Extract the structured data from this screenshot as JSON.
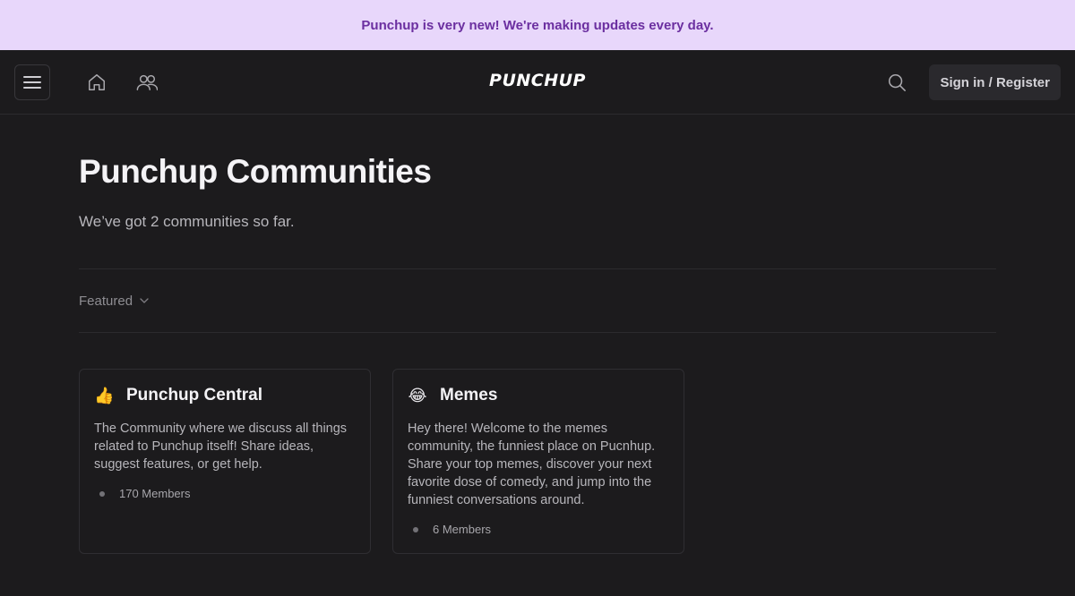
{
  "banner": {
    "text": "Punchup is very new! We're making updates every day."
  },
  "navbar": {
    "menu_icon": "hamburger-menu-icon",
    "home_icon": "home-icon",
    "communities_icon": "people-icon",
    "logo_text": "PUNCHUP",
    "search_icon": "search-icon",
    "signin_label": "Sign in / Register"
  },
  "main": {
    "title": "Punchup Communities",
    "subtitle": "We’ve got 2 communities so far.",
    "filter": {
      "selected": "Featured",
      "icon": "chevron-down-icon"
    },
    "communities": [
      {
        "emoji": "👍",
        "name": "Punchup Central",
        "description": "The Community where we discuss all things related to Punchup itself! Share ideas, suggest features, or get help.",
        "members": "170 Members"
      },
      {
        "emoji": "😂",
        "name": "Memes",
        "description": "Hey there! Welcome to the memes community, the funniest place on Pucnhup. Share your top memes, discover your next favorite dose of comedy, and jump into the funniest conversations around.",
        "members": "6 Members"
      }
    ]
  },
  "colors": {
    "background": "#1c1b1d",
    "banner_bg": "#e8d7fb",
    "banner_text": "#6b2fa0",
    "button_bg": "#2a292d"
  }
}
